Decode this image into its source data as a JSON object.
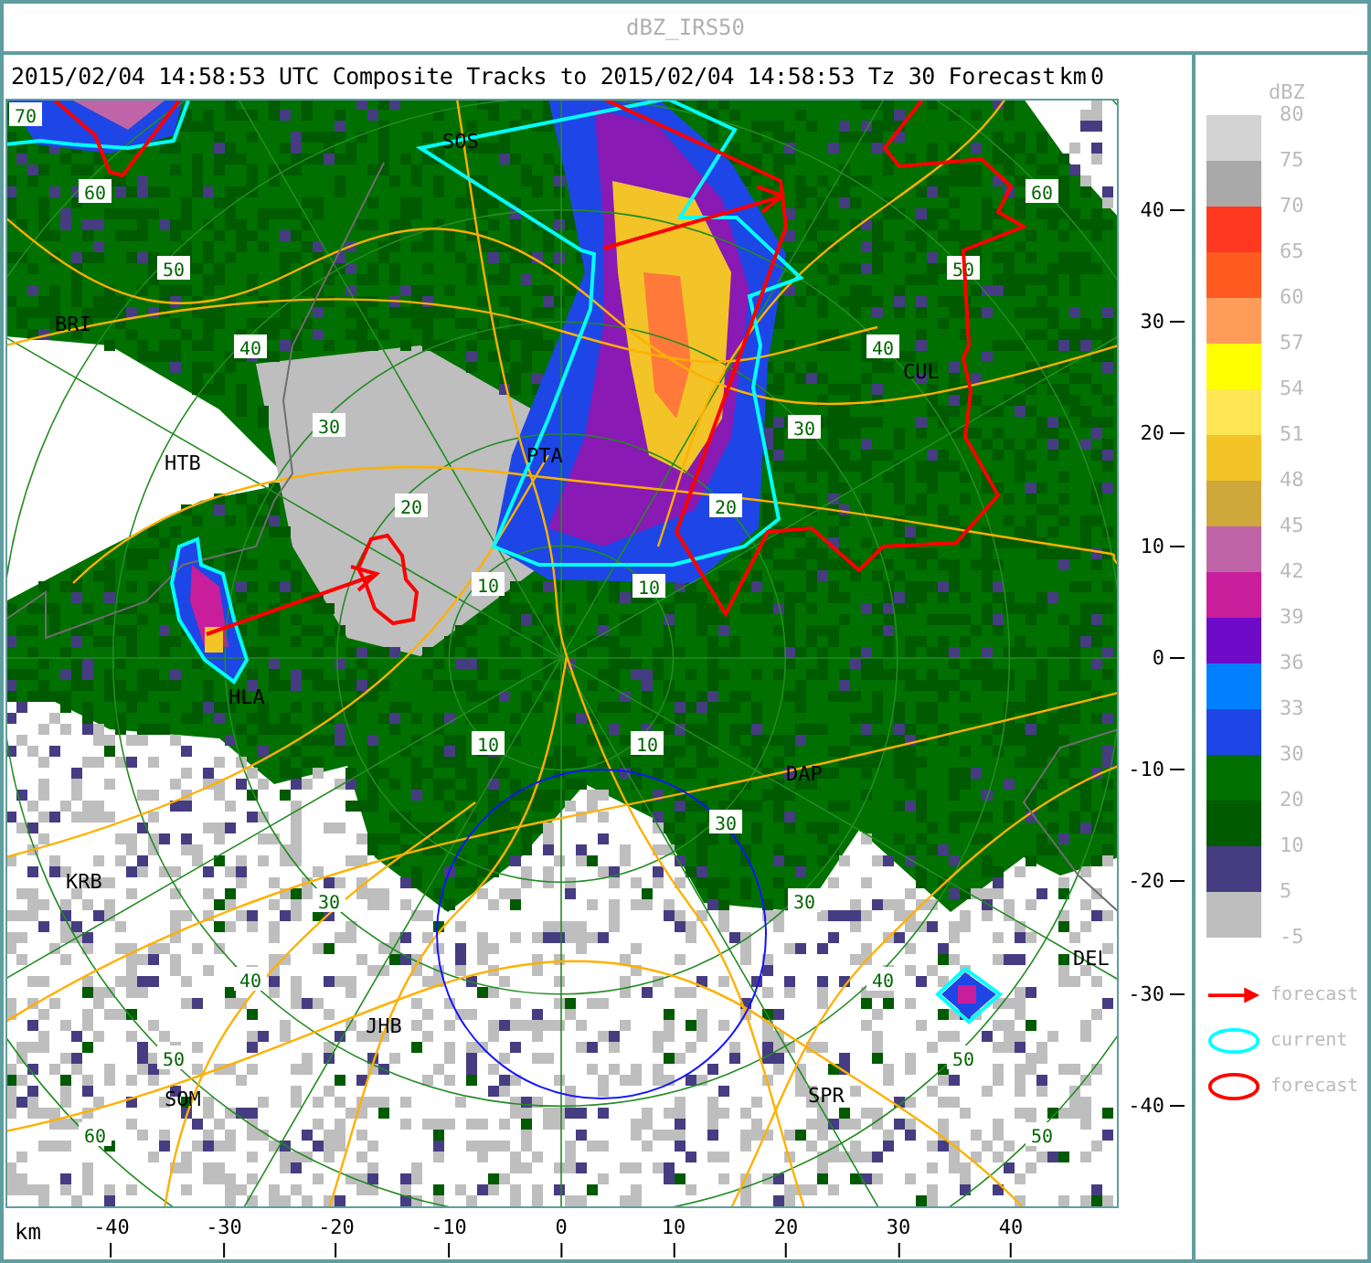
{
  "window": {
    "title": "dBZ_IRS50"
  },
  "header": {
    "title": "2015/02/04 14:58:53 UTC Composite Tracks to 2015/02/04 14:58:53 Tz 30 Forecast"
  },
  "map": {
    "stations": [
      "SOS",
      "BRI",
      "HTB",
      "PTA",
      "HLA",
      "CUL",
      "DAP",
      "KRB",
      "JHB",
      "SOM",
      "SPR",
      "DEL"
    ],
    "range_labels": [
      "70",
      "60",
      "50",
      "40",
      "30",
      "20",
      "10",
      "10",
      "20",
      "30",
      "40",
      "50",
      "60",
      "10",
      "30",
      "30",
      "40",
      "50",
      "50",
      "10",
      "30",
      "40",
      "50",
      "60"
    ]
  },
  "y_axis": {
    "unit": "km",
    "top_tick": "0",
    "ticks": [
      "40",
      "30",
      "20",
      "10",
      "0",
      "-10",
      "-20",
      "-30",
      "-40"
    ]
  },
  "x_axis": {
    "unit": "km",
    "ticks": [
      "-40",
      "-30",
      "-20",
      "-10",
      "0",
      "10",
      "20",
      "30",
      "40"
    ]
  },
  "legend": {
    "title": "dBZ",
    "bottom_label": "-5",
    "bins": [
      {
        "label": "80",
        "color": "#d3d3d3"
      },
      {
        "label": "75",
        "color": "#a9a9a9"
      },
      {
        "label": "70",
        "color": "#ff3920"
      },
      {
        "label": "65",
        "color": "#ff5a20"
      },
      {
        "label": "60",
        "color": "#ff9c5a"
      },
      {
        "label": "57",
        "color": "#ffff00"
      },
      {
        "label": "54",
        "color": "#ffe655"
      },
      {
        "label": "51",
        "color": "#f2c428"
      },
      {
        "label": "48",
        "color": "#cfa83c"
      },
      {
        "label": "45",
        "color": "#c064a8"
      },
      {
        "label": "42",
        "color": "#c81e9b"
      },
      {
        "label": "39",
        "color": "#6e0ac8"
      },
      {
        "label": "36",
        "color": "#0080ff"
      },
      {
        "label": "33",
        "color": "#1e46e6"
      },
      {
        "label": "30",
        "color": "#007000"
      },
      {
        "label": "20",
        "color": "#005a00"
      },
      {
        "label": "10",
        "color": "#463c82"
      },
      {
        "label": "5",
        "color": "#bebebe"
      }
    ],
    "keys": [
      {
        "kind": "arrow",
        "label": "forecast"
      },
      {
        "kind": "current",
        "label": "current"
      },
      {
        "kind": "forecast",
        "label": "forecast"
      }
    ]
  }
}
